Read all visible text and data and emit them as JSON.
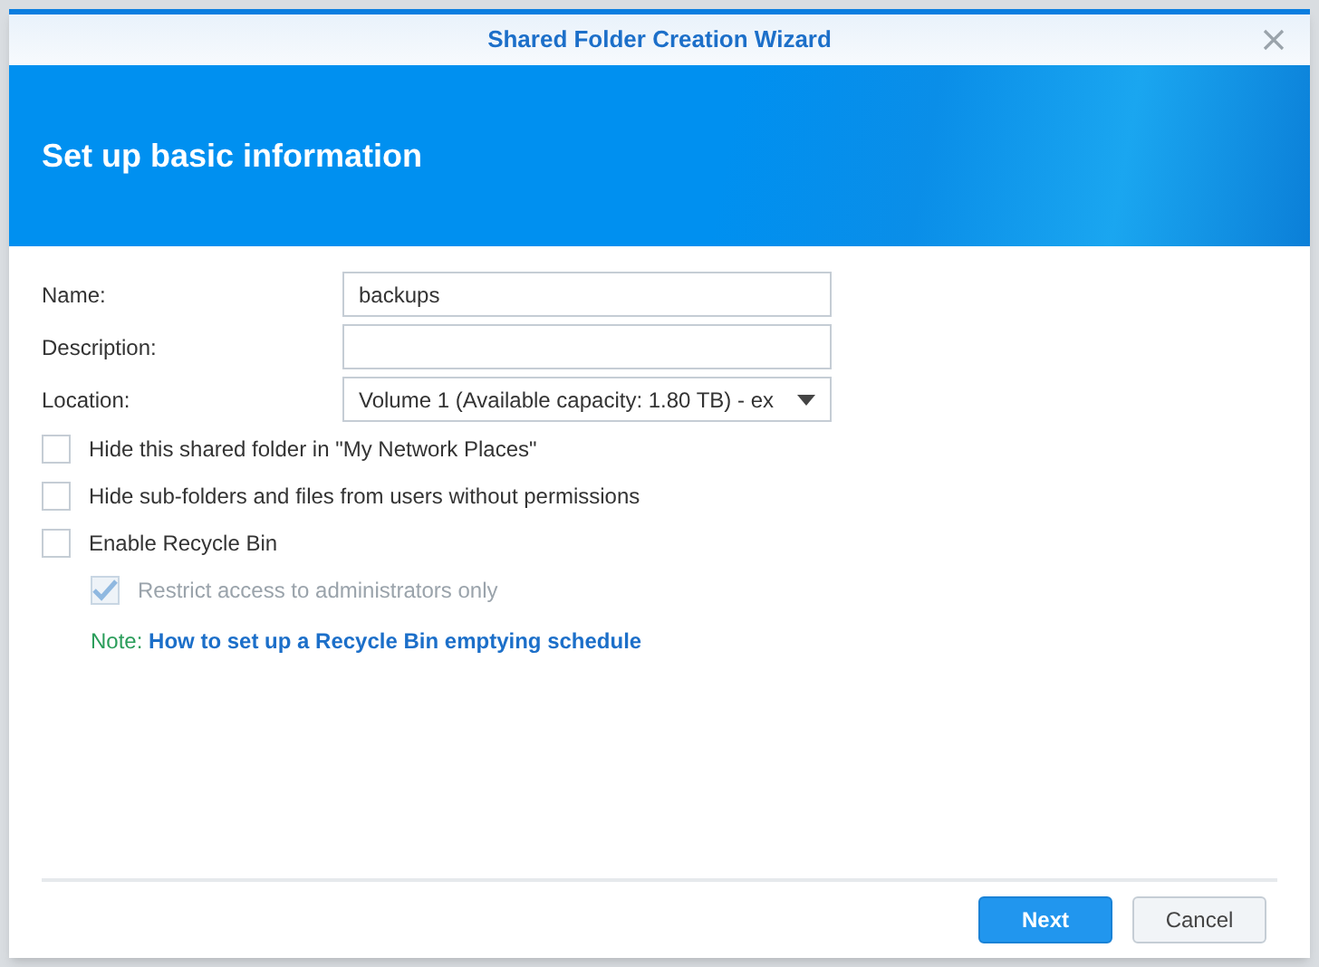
{
  "window": {
    "title": "Shared Folder Creation Wizard"
  },
  "header": {
    "title": "Set up basic information"
  },
  "fields": [
    {
      "kind": "text",
      "label": "Name:",
      "value": "backups"
    },
    {
      "kind": "text",
      "label": "Description:"
    },
    {
      "kind": "select",
      "label": "Location:",
      "value": "Volume 1 (Available capacity: 1.80 TB) - ex"
    }
  ],
  "options": [
    {
      "label": "Hide this shared folder in \"My Network Places\"",
      "checked": false,
      "disabled": false,
      "indented": false
    },
    {
      "label": "Hide sub-folders and files from users without permissions",
      "checked": false,
      "disabled": false,
      "indented": false
    },
    {
      "label": "Enable Recycle Bin",
      "checked": false,
      "disabled": false,
      "indented": false
    },
    {
      "label": "Restrict access to administrators only",
      "checked": true,
      "disabled": true,
      "indented": true
    }
  ],
  "note": {
    "prefix": "Note:",
    "link": "How to set up a Recycle Bin emptying schedule"
  },
  "buttons": [
    {
      "label": "Next",
      "kind": "primary"
    },
    {
      "label": "Cancel",
      "kind": "secondary"
    }
  ]
}
